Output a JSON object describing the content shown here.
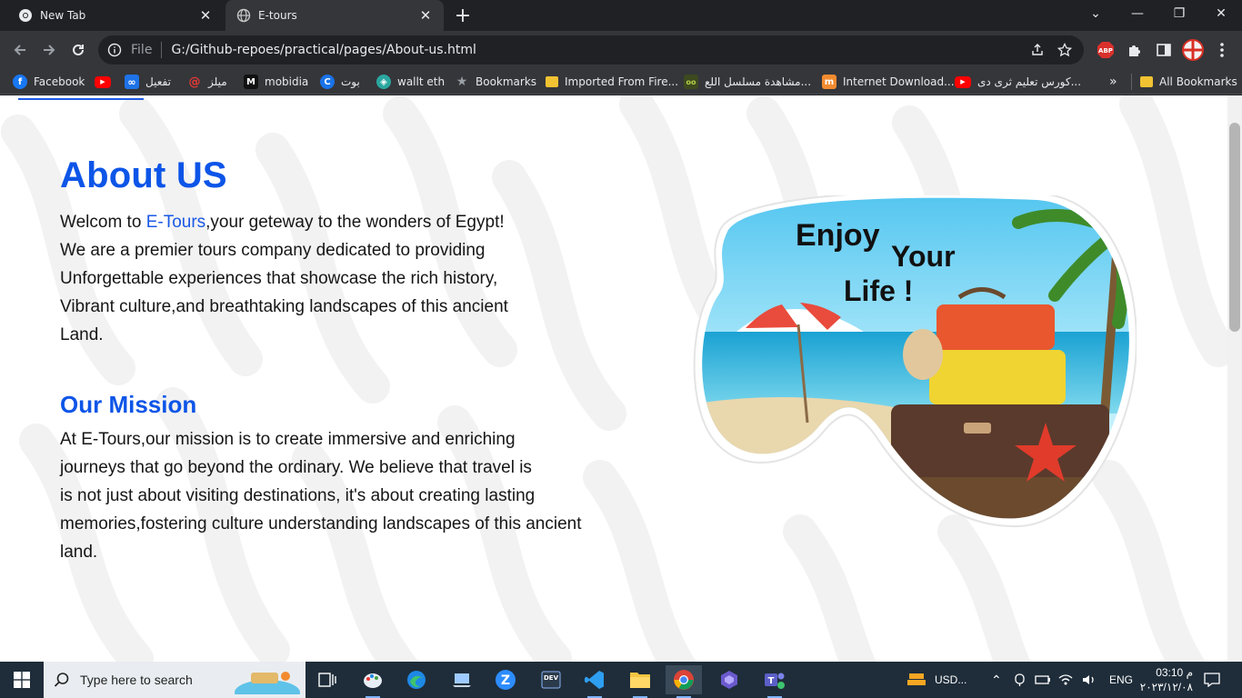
{
  "browser": {
    "tabs": [
      {
        "title": "New Tab",
        "icon": "chrome-icon"
      },
      {
        "title": "E-tours",
        "icon": "globe-icon"
      }
    ],
    "address": {
      "scheme": "File",
      "url": "G:/Github-repoes/practical/pages/About-us.html"
    },
    "bookmarks": [
      {
        "label": "Facebook",
        "icon": "facebook-icon",
        "color": "#1877f2"
      },
      {
        "label": "",
        "icon": "youtube-icon",
        "color": "#ff0000"
      },
      {
        "label": "تفعيل",
        "icon": "infinity-icon",
        "color": "#1e73e8"
      },
      {
        "label": "ميلز",
        "icon": "swirl-icon",
        "color": "#e53935"
      },
      {
        "label": "mobidia",
        "icon": "m-icon",
        "color": "#111111"
      },
      {
        "label": "بوت",
        "icon": "c-icon",
        "color": "#1a73e8"
      },
      {
        "label": "wallt eth",
        "icon": "wallet-icon",
        "color": "#2aa7a0"
      },
      {
        "label": "Bookmarks",
        "icon": "star-icon",
        "color": "#9aa0a6"
      },
      {
        "label": "Imported From Fire...",
        "icon": "folder-icon",
        "color": "#f1c232"
      },
      {
        "label": "مشاهدة مسلسل اللع...",
        "icon": "site-icon",
        "color": "#6b8e23"
      },
      {
        "label": "Internet Download...",
        "icon": "idm-icon",
        "color": "#f28b30"
      },
      {
        "label": "كورس تعليم ثرى دى...",
        "icon": "youtube-icon",
        "color": "#ff0000"
      },
      {
        "label": "All Bookmarks",
        "icon": "folder-icon",
        "color": "#f1c232"
      }
    ]
  },
  "page": {
    "heading": "About US",
    "intro_lines": [
      {
        "before": "Welcom to ",
        "accent": "E-Tours",
        "after": ",your geteway to the wonders of Egypt!"
      },
      {
        "before": "We are a premier tours company dedicated to providing",
        "accent": "",
        "after": ""
      },
      {
        "before": "Unforgettable experiences that showcase the rich history,",
        "accent": "",
        "after": ""
      },
      {
        "before": "Vibrant culture,and breathtaking landscapes of this ancient",
        "accent": "",
        "after": ""
      },
      {
        "before": "Land.",
        "accent": "",
        "after": ""
      }
    ],
    "mission_heading": "Our Mission",
    "mission_lines": [
      "At E-Tours,our mission is to create immersive and enriching",
      "journeys that go beyond the ordinary. We believe that travel is",
      "is not just about visiting destinations, it's about creating lasting",
      "memories,fostering culture understanding landscapes of this ancient",
      "land."
    ],
    "image_text": {
      "enjoy": "Enjoy",
      "your": "Your",
      "life": "Life !"
    },
    "accent_color": "#0d55e8"
  },
  "taskbar": {
    "search_placeholder": "Type here to search",
    "weather": "USD...",
    "language": "ENG",
    "time": "03:10 م",
    "date": "٢٠٢٣/١٢/٠٨"
  }
}
